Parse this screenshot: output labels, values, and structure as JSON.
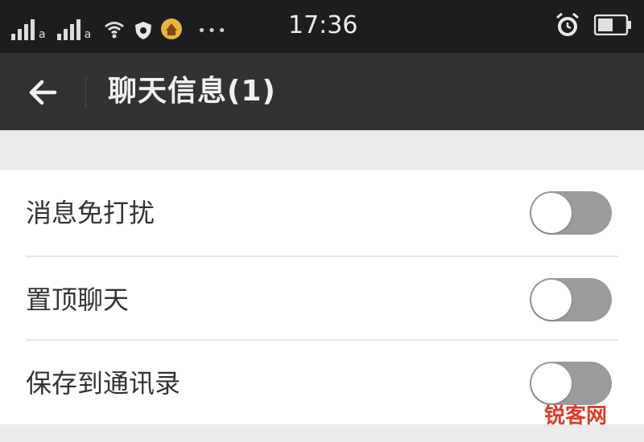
{
  "status_bar": {
    "time": "17:36",
    "signal_labels": [
      "a",
      "a"
    ],
    "icons": [
      "signal-icon",
      "signal-icon",
      "wifi-icon",
      "shield-icon",
      "app-icon",
      "more-dots-icon",
      "alarm-icon",
      "battery-icon"
    ],
    "dots": "•••"
  },
  "toolbar": {
    "title": "聊天信息(1)",
    "back_icon": "arrow-left-icon"
  },
  "settings": {
    "items": [
      {
        "label": "消息免打扰",
        "enabled": false
      },
      {
        "label": "置顶聊天",
        "enabled": false
      },
      {
        "label": "保存到通讯录",
        "enabled": false
      }
    ]
  },
  "watermark": {
    "text": "锐客网"
  },
  "colors": {
    "status_bar_bg": "#1d1d1f",
    "toolbar_bg": "#323234",
    "page_bg": "#ebebeb",
    "toggle_off": "#9b9b9b",
    "watermark": "#e23a2a"
  }
}
